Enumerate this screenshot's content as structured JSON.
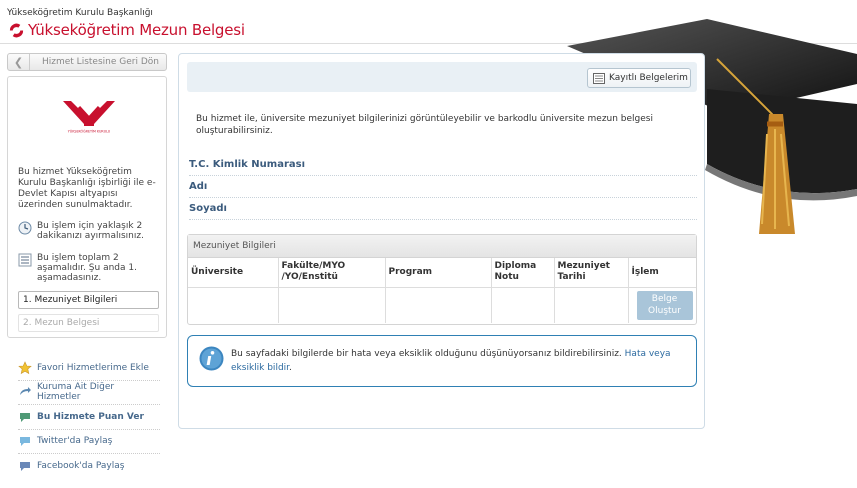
{
  "header": {
    "subtitle": "Yükseköğretim Kurulu Başkanlığı",
    "title": "Yükseköğretim Mezun Belgesi"
  },
  "sidebar": {
    "back_label": "Hizmet Listesine Geri Dön",
    "logo_caption": "YÜKSEKÖĞRETİM KURULU",
    "description": "Bu hizmet Yükseköğretim Kurulu Başkanlığı işbirliği ile e-Devlet Kapısı altyapısı üzerinden sunulmaktadır.",
    "time_note": "Bu işlem için yaklaşık 2 dakikanızı ayırmalısınız.",
    "steps_note": "Bu işlem toplam 2 aşamalıdır. Şu anda 1. aşamadasınız.",
    "steps": [
      "1. Mezuniyet Bilgileri",
      "2. Mezun Belgesi"
    ],
    "links": [
      {
        "label": "Favori Hizmetlerime Ekle",
        "icon": "star-icon"
      },
      {
        "label": "Kuruma Ait Diğer Hizmetler",
        "icon": "arrow-icon"
      },
      {
        "label": "Bu Hizmete Puan Ver",
        "icon": "rating-icon"
      },
      {
        "label": "Twitter'da Paylaş",
        "icon": "twitter-icon"
      },
      {
        "label": "Facebook'da Paylaş",
        "icon": "facebook-icon"
      }
    ]
  },
  "main": {
    "records_button": "Kayıtlı Belgelerim",
    "intro": "Bu hizmet ile, üniversite mezuniyet bilgilerinizi görüntüleyebilir ve barkodlu üniversite mezun belgesi oluşturabilirsiniz.",
    "fields": [
      "T.C. Kimlik Numarası",
      "Adı",
      "Soyadı"
    ],
    "grid_title": "Mezuniyet Bilgileri",
    "columns": [
      "Üniversite",
      "Fakülte/MYO /YO/Enstitü",
      "Program",
      "Diploma Notu",
      "Mezuniyet Tarihi",
      "İşlem"
    ],
    "create_button": "Belge Oluştur",
    "info_text": "Bu sayfadaki bilgilerde bir hata veya eksiklik olduğunu düşünüyorsanız bildirebilirsiniz.",
    "info_link": "Hata veya eksiklik bildir",
    "info_end": "."
  },
  "colors": {
    "brand_red": "#c8102e",
    "link_blue": "#47698c",
    "info_border": "#2f80b4"
  }
}
